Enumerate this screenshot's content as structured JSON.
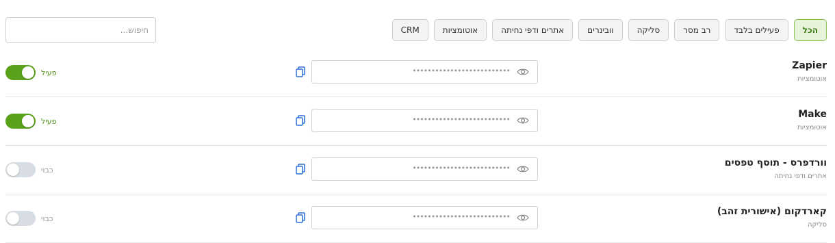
{
  "filters": [
    {
      "label": "הכל",
      "active": true
    },
    {
      "label": "פעילים בלבד",
      "active": false
    },
    {
      "label": "רב מסר",
      "active": false
    },
    {
      "label": "סליקה",
      "active": false
    },
    {
      "label": "וובינרים",
      "active": false
    },
    {
      "label": "אתרים ודפי נחיתה",
      "active": false
    },
    {
      "label": "אוטומציות",
      "active": false
    },
    {
      "label": "CRM",
      "active": false
    }
  ],
  "search": {
    "placeholder": "חיפוש..."
  },
  "integrations": [
    {
      "title": "Zapier",
      "category": "אוטומציות",
      "key_mask": "••••••••••••••••••••••••••",
      "active": true,
      "status_label": "פעיל"
    },
    {
      "title": "Make",
      "category": "אוטומציות",
      "key_mask": "••••••••••••••••••••••••••",
      "active": true,
      "status_label": "פעיל"
    },
    {
      "title": "וורדפרס - תוסף טפסים",
      "category": "אתרים ודפי נחיתה",
      "key_mask": "••••••••••••••••••••••••••",
      "active": false,
      "status_label": "כבוי"
    },
    {
      "title": "קארדקום (אישורית זהב)",
      "category": "סליקה",
      "key_mask": "••••••••••••••••••••••••••",
      "active": false,
      "status_label": "כבוי"
    }
  ],
  "colors": {
    "accent": "#5aa21a",
    "copy_icon": "#2a6fdb"
  }
}
